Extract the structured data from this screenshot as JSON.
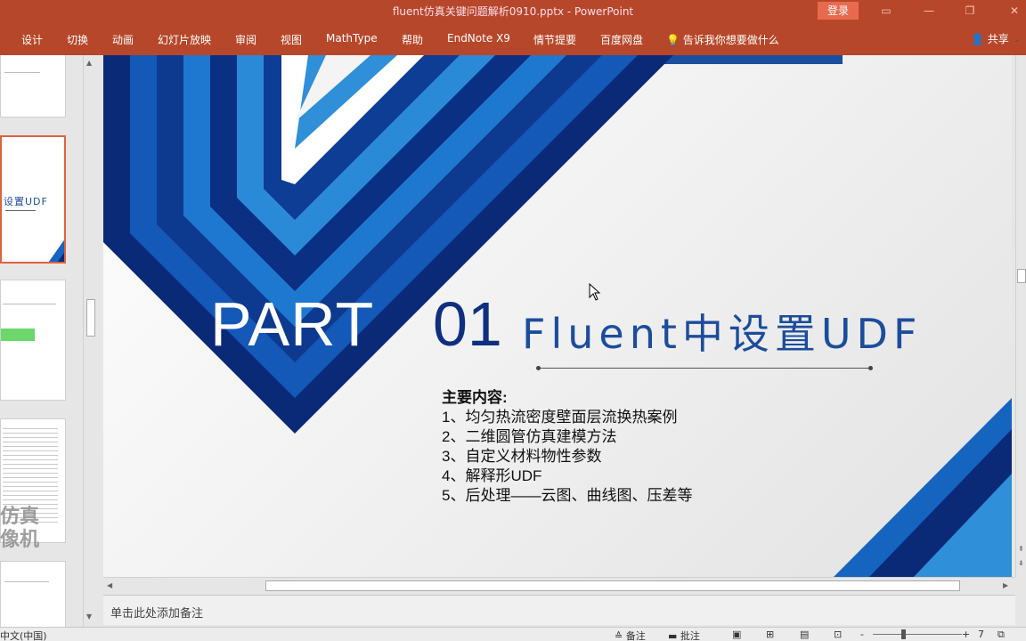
{
  "window": {
    "title": "fluent仿真关键问题解析0910.pptx  -  PowerPoint",
    "login_label": "登录",
    "controls": [
      "restore-ribbon",
      "minimize",
      "maximize",
      "close"
    ]
  },
  "ribbon": {
    "tabs": [
      "设计",
      "切换",
      "动画",
      "幻灯片放映",
      "审阅",
      "视图",
      "MathType",
      "帮助",
      "EndNote X9",
      "情节提要",
      "百度网盘"
    ],
    "tell_me": "告诉我你想要做什么",
    "share": "共享"
  },
  "thumbnail_pane": {
    "selected_thumb_text": "设置UDF",
    "watermark_lines": [
      "仿真",
      "像机"
    ]
  },
  "slide": {
    "part_label": "PART",
    "part_number": "01",
    "heading": "Fluent中设置UDF",
    "contents_label": "主要内容:",
    "items": [
      "1、均匀热流密度壁面层流换热案例",
      "2、二维圆管仿真建模方法",
      "3、自定义材料物性参数",
      "4、解释形UDF",
      "5、后处理——云图、曲线图、压差等"
    ],
    "colors": {
      "deep_blue": "#0a2a78",
      "mid_blue": "#1565c0",
      "light_blue": "#2f8fd8"
    }
  },
  "notes": {
    "placeholder": "单击此处添加备注"
  },
  "status_bar": {
    "language": "中文(中国)",
    "notes_button": "备注",
    "comments_button": "批注",
    "zoom_minus": "-",
    "zoom_plus": "+",
    "zoom_value": "7",
    "fit_icon": "fit-slide-icon"
  }
}
